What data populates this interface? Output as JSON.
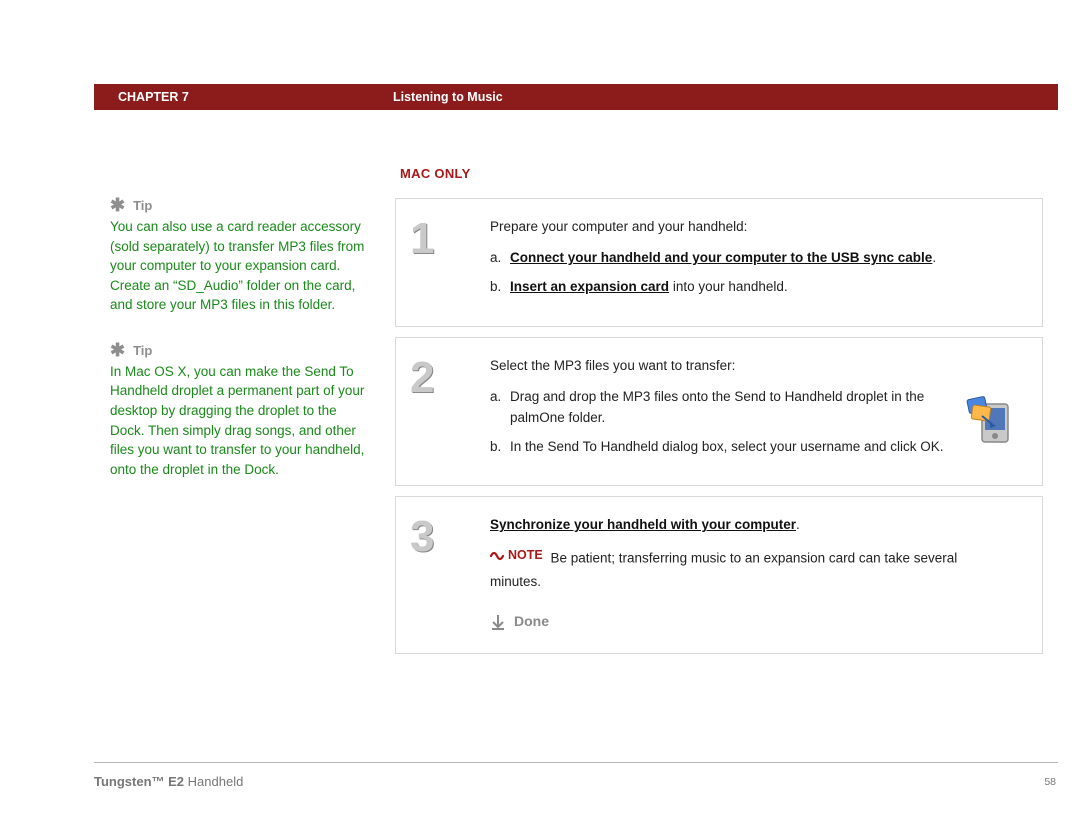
{
  "header": {
    "chapter": "CHAPTER 7",
    "title": "Listening to Music"
  },
  "platform_label": "MAC ONLY",
  "sidebar": {
    "tips": [
      {
        "title": "Tip",
        "body": "You can also use a card reader accessory (sold separately) to transfer MP3 files from your computer to your expansion card. Create an “SD_Audio” folder on the card, and store your MP3 files in this folder."
      },
      {
        "title": "Tip",
        "body": "In Mac OS X, you can make the Send To Handheld droplet a permanent part of your desktop by dragging the droplet to the Dock. Then simply drag songs, and other files you want to transfer to your handheld, onto the droplet in the Dock."
      }
    ]
  },
  "steps": [
    {
      "num": "1",
      "intro": "Prepare your computer and your handheld:",
      "subs": [
        {
          "letter": "a.",
          "link": "Connect your handheld and your computer to the USB sync cable",
          "after": "."
        },
        {
          "letter": "b.",
          "link": "Insert an expansion card",
          "after": " into your handheld."
        }
      ]
    },
    {
      "num": "2",
      "intro": "Select the MP3 files you want to transfer:",
      "subs": [
        {
          "letter": "a.",
          "plain": "Drag and drop the MP3 files onto the Send to Handheld droplet in the palmOne folder."
        },
        {
          "letter": "b.",
          "plain": "In the Send To Handheld dialog box, select your username and click OK."
        }
      ],
      "has_icon": true
    },
    {
      "num": "3",
      "sync_link": "Synchronize your handheld with your computer",
      "sync_after": ".",
      "note_label": "NOTE",
      "note_body_1": "Be patient; transferring music to an expansion card can take several",
      "note_body_2": "minutes.",
      "done_label": "Done"
    }
  ],
  "footer": {
    "product_bold": "Tungsten™ E2",
    "product_rest": " Handheld",
    "page": "58"
  }
}
